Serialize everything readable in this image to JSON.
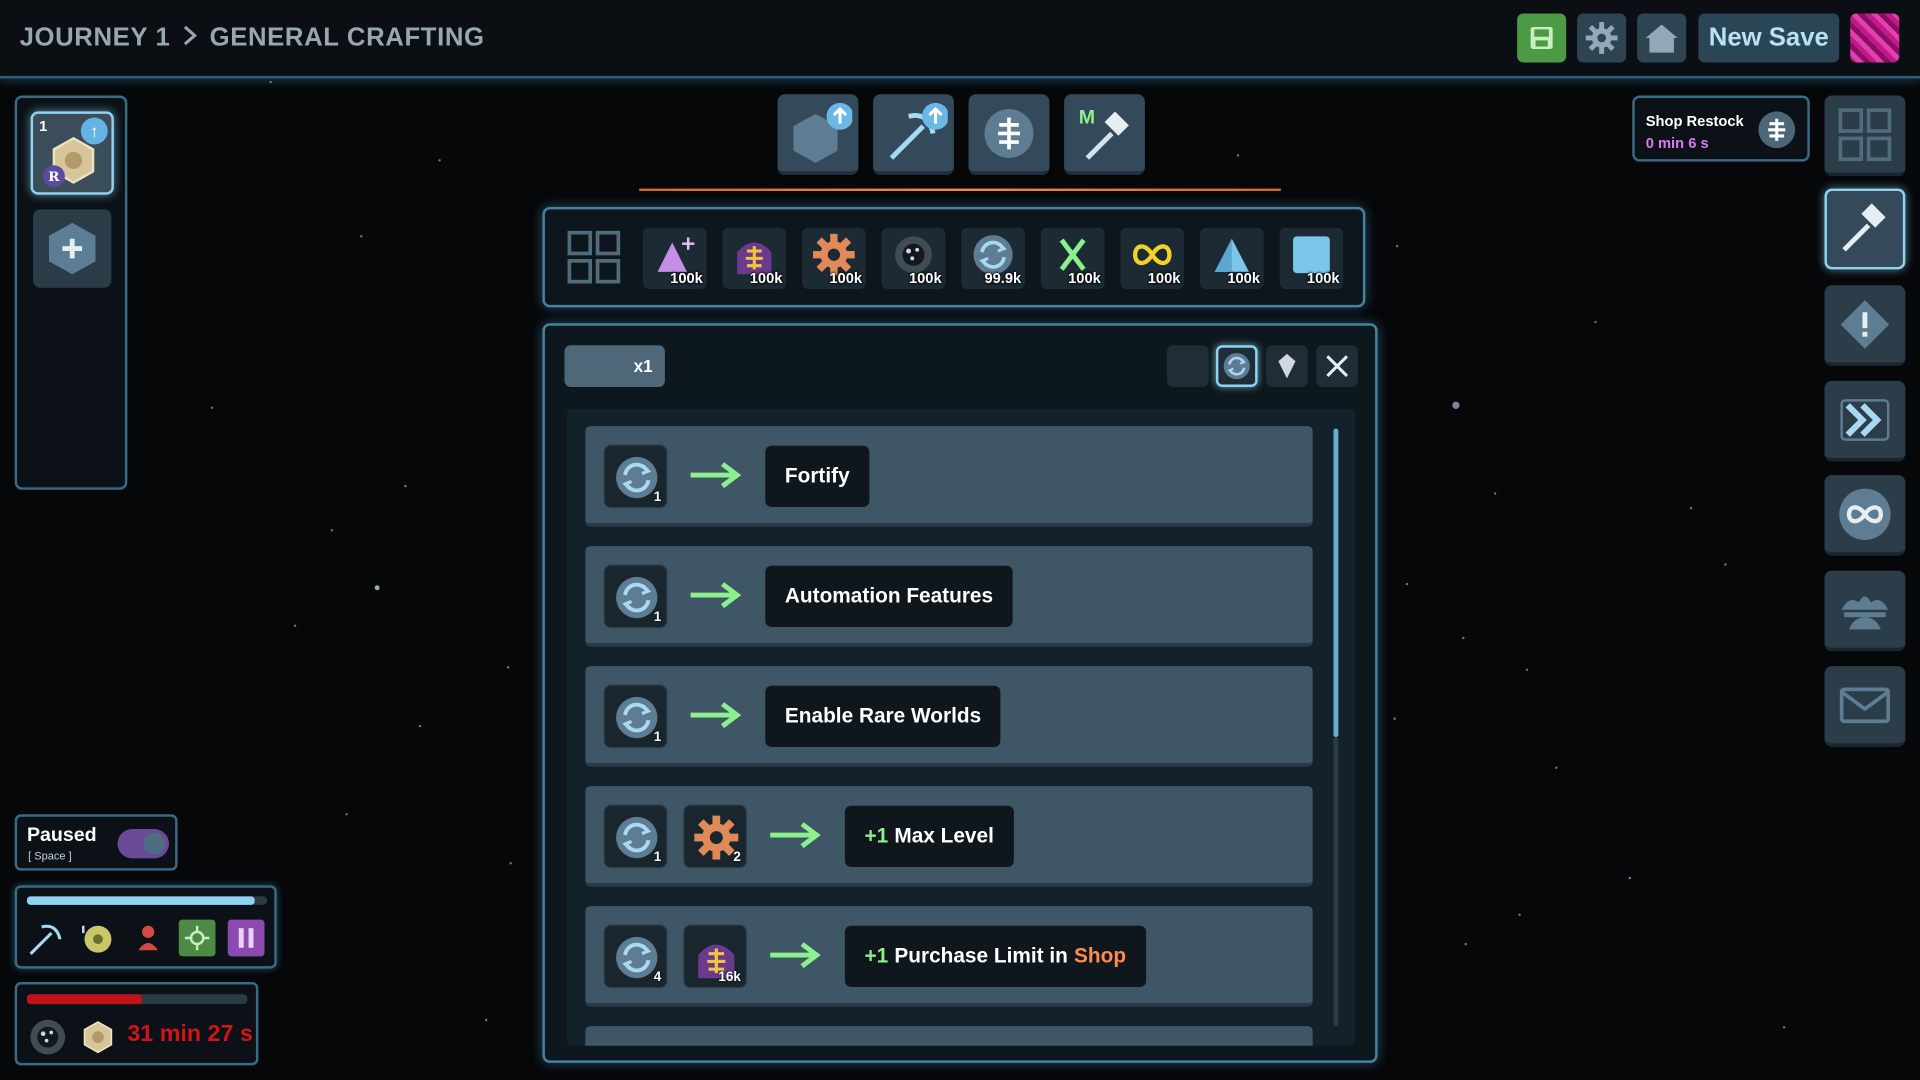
{
  "header": {
    "breadcrumb": [
      "JOURNEY 1",
      "GENERAL CRAFTING"
    ],
    "new_save_label": "New Save",
    "icons": [
      "save-icon",
      "gear-icon",
      "home-icon",
      "avatar"
    ]
  },
  "left_panel": {
    "world_slot": {
      "number": "1",
      "badge": "R"
    }
  },
  "tools": [
    "world-upgrade",
    "pickaxe-upgrade",
    "token",
    "master-hammer"
  ],
  "tools_master_letter": "M",
  "resources": [
    {
      "name": "crystal",
      "amount": "100k"
    },
    {
      "name": "token",
      "amount": "100k"
    },
    {
      "name": "gear",
      "amount": "100k"
    },
    {
      "name": "dark-orb",
      "amount": "100k"
    },
    {
      "name": "refresh",
      "amount": "99.9k"
    },
    {
      "name": "x",
      "amount": "100k"
    },
    {
      "name": "infinity",
      "amount": "100k"
    },
    {
      "name": "triangle",
      "amount": "100k"
    },
    {
      "name": "square",
      "amount": "100k"
    }
  ],
  "upgrade_panel": {
    "multiplier": "x1",
    "upgrades": [
      {
        "costs": [
          {
            "icon": "refresh-icon",
            "amount": "1"
          }
        ],
        "effect": "Fortify"
      },
      {
        "costs": [
          {
            "icon": "refresh-icon",
            "amount": "1"
          }
        ],
        "effect": "Automation Features"
      },
      {
        "costs": [
          {
            "icon": "refresh-icon",
            "amount": "1"
          }
        ],
        "effect": "Enable Rare Worlds"
      },
      {
        "costs": [
          {
            "icon": "refresh-icon",
            "amount": "1"
          },
          {
            "icon": "gear-icon",
            "amount": "2"
          }
        ],
        "effect_plus": "+1",
        "effect": "Max Level"
      },
      {
        "costs": [
          {
            "icon": "refresh-icon",
            "amount": "4"
          },
          {
            "icon": "token-icon",
            "amount": "16k"
          }
        ],
        "effect_plus": "+1",
        "effect": "Purchase Limit in",
        "effect_highlight": "Shop"
      }
    ]
  },
  "shop_restock": {
    "title": "Shop Restock",
    "time": "0 min 6 s"
  },
  "status": {
    "paused_label": "Paused",
    "paused_key": "[ Space ]",
    "paused_on": true,
    "miner_progress": 0.95,
    "timer": "31 min 27 s",
    "timer_progress": 0.52
  },
  "colors": {
    "accent": "#8fd2f2",
    "panel_border": "#3a6a85",
    "row_bg": "#3e5665",
    "arrow": "#8cf08c",
    "shop_text": "#ff8c4a",
    "timer_text": "#d01418"
  }
}
